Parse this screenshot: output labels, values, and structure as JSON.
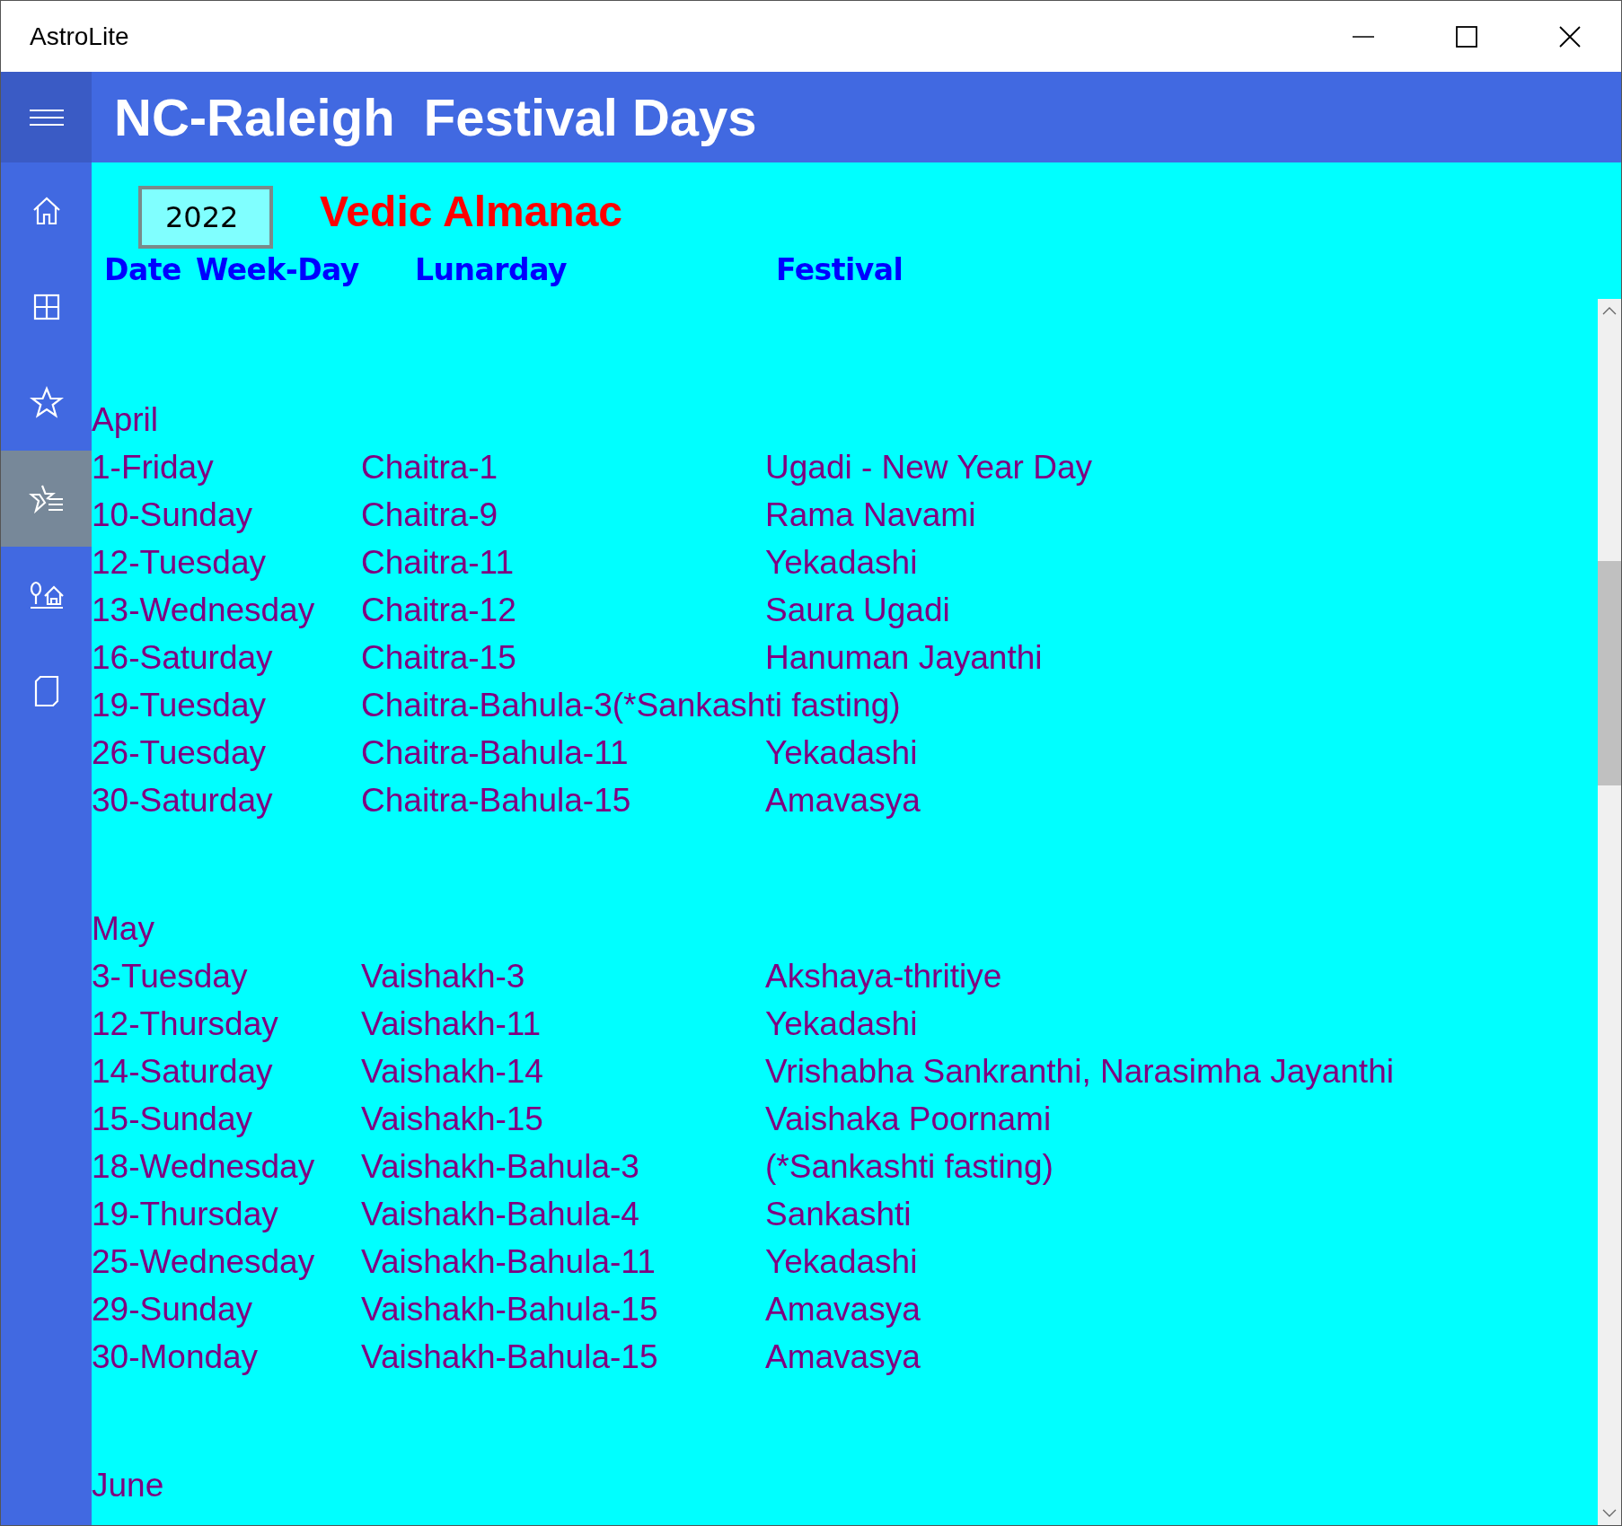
{
  "window": {
    "title": "AstroLite"
  },
  "header": {
    "title": "NC-Raleigh  Festival Days"
  },
  "sidebar": {
    "items": [
      {
        "selected": false
      },
      {
        "selected": false
      },
      {
        "selected": false
      },
      {
        "selected": true
      },
      {
        "selected": false
      },
      {
        "selected": false
      }
    ]
  },
  "year_field": {
    "value": "2022"
  },
  "almanac_title": "Vedic Almanac",
  "columns": [
    "Date",
    "Week-Day",
    "Lunarday",
    "Festival"
  ],
  "months": [
    {
      "name": "April",
      "rows": [
        {
          "date": "1-Friday",
          "lunarday": "Chaitra-1",
          "festival": "Ugadi - New Year Day"
        },
        {
          "date": "10-Sunday",
          "lunarday": "Chaitra-9",
          "festival": "Rama Navami"
        },
        {
          "date": "12-Tuesday",
          "lunarday": "Chaitra-11",
          "festival": "Yekadashi"
        },
        {
          "date": "13-Wednesday",
          "lunarday": "Chaitra-12",
          "festival": "Saura Ugadi"
        },
        {
          "date": "16-Saturday",
          "lunarday": "Chaitra-15",
          "festival": "Hanuman Jayanthi"
        },
        {
          "date": "19-Tuesday",
          "lunarday": "Chaitra-Bahula-3(*Sankashti fasting)"
        },
        {
          "date": "26-Tuesday",
          "lunarday": "Chaitra-Bahula-11",
          "festival": "Yekadashi"
        },
        {
          "date": "30-Saturday",
          "lunarday": "Chaitra-Bahula-15",
          "festival": "Amavasya"
        }
      ]
    },
    {
      "name": "May",
      "rows": [
        {
          "date": "3-Tuesday",
          "lunarday": "Vaishakh-3",
          "festival": "Akshaya-thritiye"
        },
        {
          "date": "12-Thursday",
          "lunarday": "Vaishakh-11",
          "festival": "Yekadashi"
        },
        {
          "date": "14-Saturday",
          "lunarday": "Vaishakh-14",
          "festival": "Vrishabha Sankranthi, Narasimha Jayanthi"
        },
        {
          "date": "15-Sunday",
          "lunarday": "Vaishakh-15",
          "festival": "Vaishaka Poornami"
        },
        {
          "date": "18-Wednesday",
          "lunarday": "Vaishakh-Bahula-3",
          "festival": "(*Sankashti fasting)"
        },
        {
          "date": "19-Thursday",
          "lunarday": "Vaishakh-Bahula-4",
          "festival": "Sankashti"
        },
        {
          "date": "25-Wednesday",
          "lunarday": "Vaishakh-Bahula-11",
          "festival": "Yekadashi"
        },
        {
          "date": "29-Sunday",
          "lunarday": "Vaishakh-Bahula-15",
          "festival": "Amavasya"
        },
        {
          "date": "30-Monday",
          "lunarday": "Vaishakh-Bahula-15",
          "festival": "Amavasya"
        }
      ]
    },
    {
      "name": "June"
    }
  ]
}
